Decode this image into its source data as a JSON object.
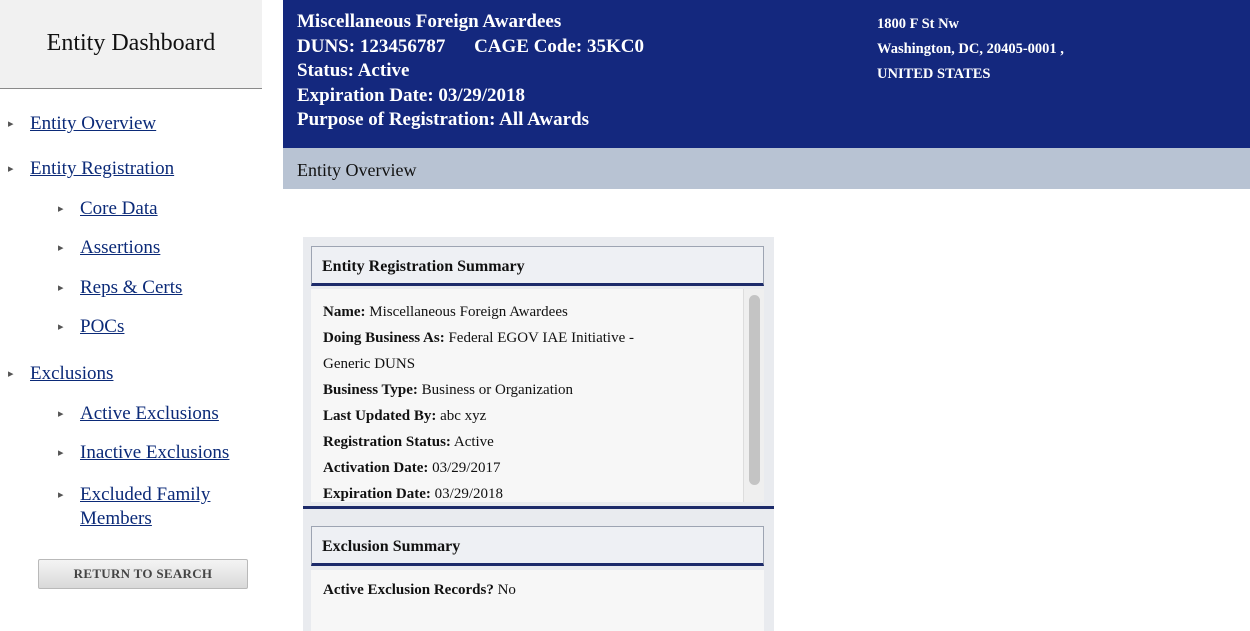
{
  "sidebar": {
    "title": "Entity Dashboard",
    "items": [
      {
        "label": "Entity Overview"
      },
      {
        "label": "Entity Registration"
      },
      {
        "label": "Core Data"
      },
      {
        "label": "Assertions"
      },
      {
        "label": "Reps & Certs"
      },
      {
        "label": "POCs"
      },
      {
        "label": "Exclusions"
      },
      {
        "label": "Active Exclusions"
      },
      {
        "label": "Inactive Exclusions"
      },
      {
        "label": "Excluded Family",
        "label2": "Members"
      }
    ],
    "return_button": "RETURN TO SEARCH"
  },
  "header": {
    "name": "Miscellaneous Foreign Awardees",
    "duns_label": "DUNS:",
    "duns": "123456787",
    "cage_label": "CAGE Code:",
    "cage": "35KC0",
    "status": "Status: Active",
    "expiration": "Expiration Date: 03/29/2018",
    "purpose": "Purpose of Registration: All Awards",
    "address": {
      "line1": "1800 F St Nw",
      "line2": "Washington, DC, 20405-0001 ,",
      "line3": "UNITED STATES"
    }
  },
  "subbar": {
    "title": "Entity Overview"
  },
  "registration_summary": {
    "heading": "Entity Registration Summary",
    "fields": [
      {
        "label": "Name:",
        "value": "Miscellaneous Foreign Awardees"
      },
      {
        "label": "Doing Business As:",
        "value": "Federal EGOV IAE Initiative -",
        "value2": "Generic DUNS"
      },
      {
        "label": "Business Type:",
        "value": "Business or Organization"
      },
      {
        "label": "Last Updated By:",
        "value": "abc xyz"
      },
      {
        "label": "Registration Status:",
        "value": "Active"
      },
      {
        "label": "Activation Date:",
        "value": "03/29/2017"
      },
      {
        "label": "Expiration Date:",
        "value": "03/29/2018"
      }
    ]
  },
  "exclusion_summary": {
    "heading": "Exclusion Summary",
    "label": "Active Exclusion Records?",
    "value": "No"
  }
}
